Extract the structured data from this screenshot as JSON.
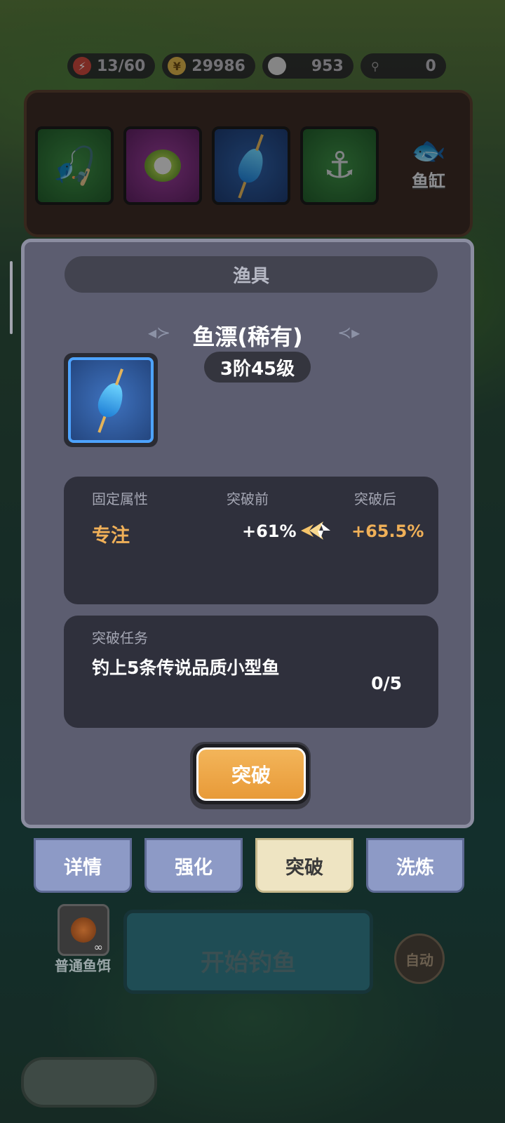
{
  "resources": [
    {
      "icon": "energy-icon",
      "value": "13/60"
    },
    {
      "icon": "coin-icon",
      "value": "29986"
    },
    {
      "icon": "pearl-icon",
      "value": "953"
    },
    {
      "icon": "hook-token-icon",
      "value": "0"
    }
  ],
  "gear_slots": [
    {
      "name": "fishing-rod",
      "icon": "rod-icon",
      "rarity": "green"
    },
    {
      "name": "fishing-line",
      "icon": "spool-icon",
      "rarity": "purple"
    },
    {
      "name": "float",
      "icon": "bobber-icon",
      "rarity": "blue"
    },
    {
      "name": "hook",
      "icon": "hook-icon",
      "rarity": "green"
    }
  ],
  "fish_tank": {
    "label": "鱼缸"
  },
  "dialog": {
    "title": "渔具",
    "item_name": "鱼漂(稀有)",
    "item_level": "3阶45级",
    "attributes": {
      "header_fixed": "固定属性",
      "header_before": "突破前",
      "header_after": "突破后",
      "name": "专注",
      "before": "+61%",
      "after": "+65.5%"
    },
    "task": {
      "title": "突破任务",
      "description": "钓上5条传说品质小型鱼",
      "progress": "0/5"
    },
    "break_button": "突破"
  },
  "tabs": [
    {
      "label": "详情",
      "active": false
    },
    {
      "label": "强化",
      "active": false
    },
    {
      "label": "突破",
      "active": true
    },
    {
      "label": "洗炼",
      "active": false
    }
  ],
  "bottom": {
    "bait_label": "普通鱼饵",
    "bait_count": "∞",
    "start_button": "开始钓鱼",
    "auto_button": "自动"
  }
}
